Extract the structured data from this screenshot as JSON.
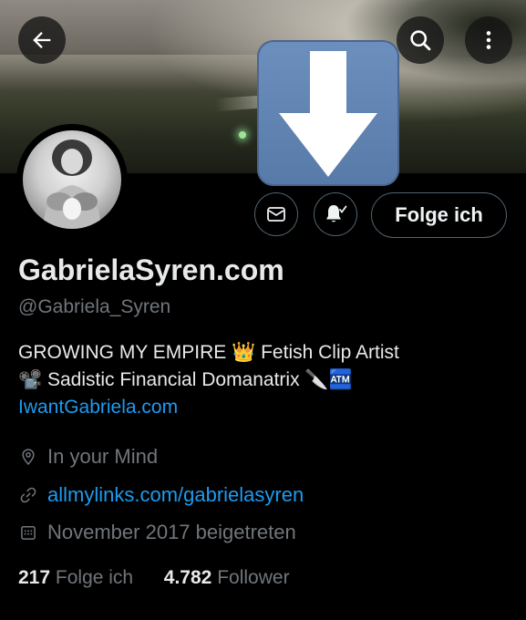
{
  "profile": {
    "display_name": "GabrielaSyren.com",
    "handle": "@Gabriela_Syren",
    "bio_line1": "GROWING MY EMPIRE 👑 Fetish Clip Artist",
    "bio_line2": "📽️ Sadistic Financial Domanatrix 🔪🏧",
    "bio_link": "IwantGabriela.com",
    "location": "In your Mind",
    "website": "allmylinks.com/gabrielasyren",
    "joined": "November 2017 beigetreten"
  },
  "actions": {
    "follow_label": "Folge ich"
  },
  "stats": {
    "following_count": "217",
    "following_label": "Folge ich",
    "followers_count": "4.782",
    "followers_label": "Follower"
  },
  "icons": {
    "back": "arrow-left-icon",
    "search": "search-icon",
    "more": "more-vertical-icon",
    "download": "download-arrow-icon",
    "message": "envelope-icon",
    "notifications": "bell-check-icon",
    "location": "location-pin-icon",
    "link": "link-icon",
    "calendar": "calendar-icon"
  },
  "colors": {
    "link": "#1d9bf0",
    "secondary_text": "#71767b",
    "border": "#536471",
    "background": "#000000"
  }
}
